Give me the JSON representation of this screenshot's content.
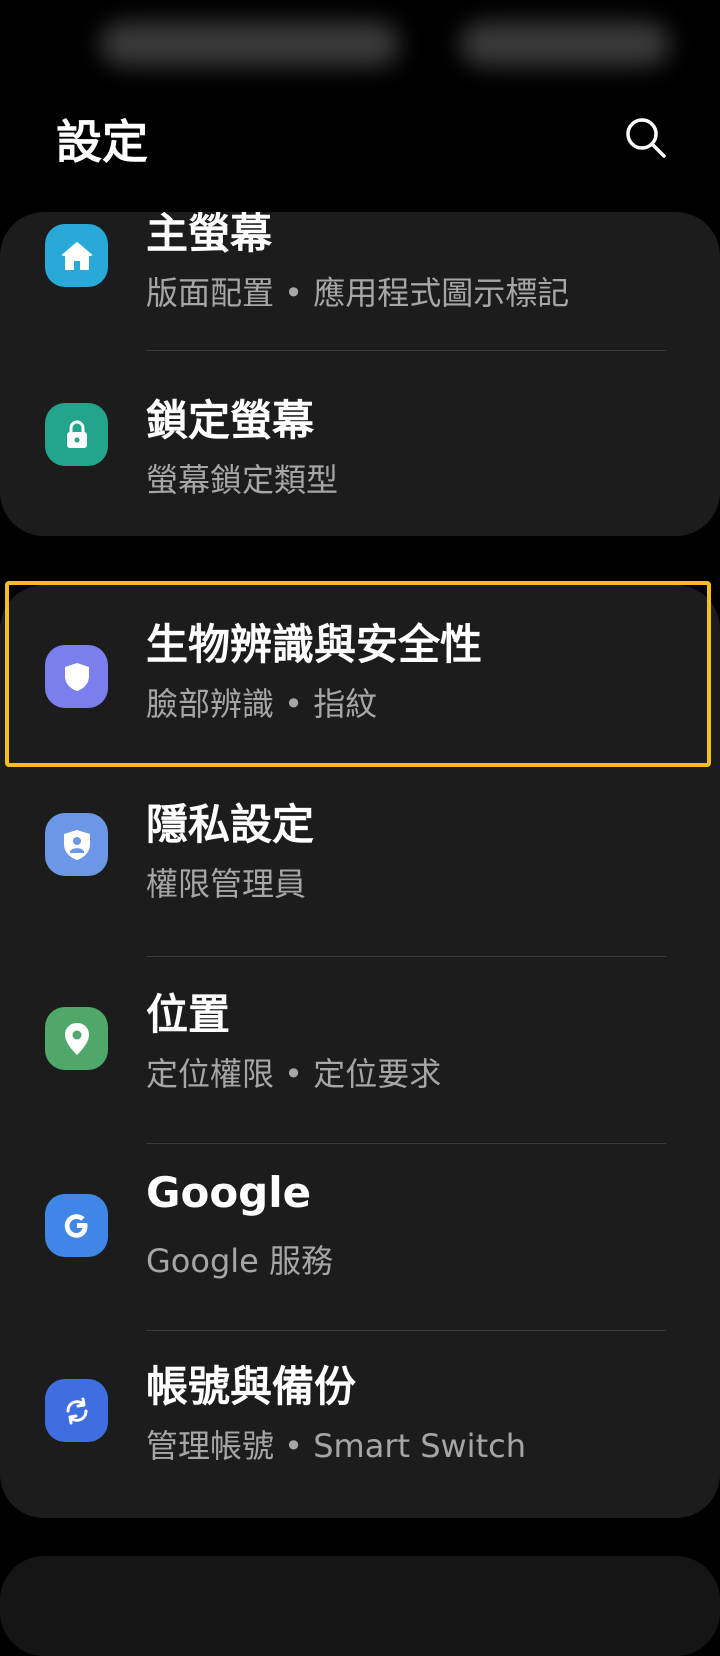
{
  "header": {
    "title": "設定",
    "search_icon": "search-icon"
  },
  "colors": {
    "background": "#000000",
    "card": "#1c1c1c",
    "highlight": "#f5be1c",
    "subtitle": "#a6a6a6"
  },
  "groups": [
    {
      "items": [
        {
          "title": "主螢幕",
          "subtitle": "版面配置 • 應用程式圖示標記",
          "icon": "home-icon",
          "icon_color": "#29a9d8"
        },
        {
          "title": "鎖定螢幕",
          "subtitle": "螢幕鎖定類型",
          "icon": "lock-icon",
          "icon_color": "#23a58c"
        }
      ]
    },
    {
      "items": [
        {
          "title": "生物辨識與安全性",
          "subtitle": "臉部辨識 • 指紋",
          "icon": "shield-icon",
          "icon_color": "#7b7fee",
          "highlighted": true
        },
        {
          "title": "隱私設定",
          "subtitle": "權限管理員",
          "icon": "privacy-shield-icon",
          "icon_color": "#6b97e6"
        },
        {
          "title": "位置",
          "subtitle": "定位權限 • 定位要求",
          "icon": "location-pin-icon",
          "icon_color": "#4fa86a"
        },
        {
          "title": "Google",
          "subtitle": "Google 服務",
          "icon": "google-icon",
          "icon_color": "#3f86e6"
        },
        {
          "title": "帳號與備份",
          "subtitle": "管理帳號 • Smart Switch",
          "icon": "sync-icon",
          "icon_color": "#3f6ee0"
        }
      ]
    }
  ]
}
